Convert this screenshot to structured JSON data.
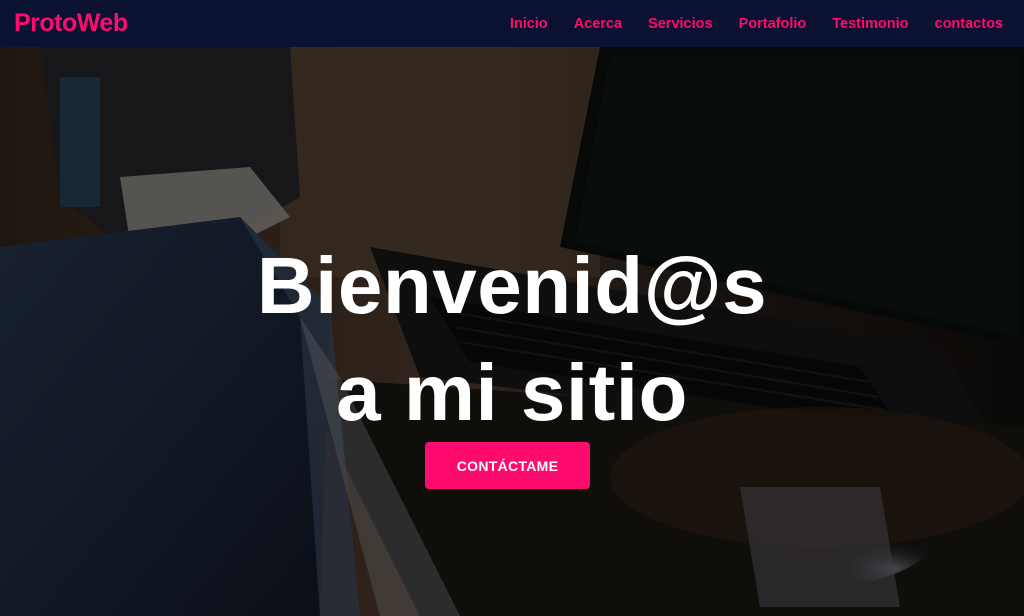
{
  "colors": {
    "accent": "#ff0b6e",
    "navbar_bg": "#0b1130",
    "hero_text": "#ffffff"
  },
  "navbar": {
    "brand": "ProtoWeb",
    "links": [
      {
        "label": "Inicio"
      },
      {
        "label": "Acerca"
      },
      {
        "label": "Servicios"
      },
      {
        "label": "Portafolio"
      },
      {
        "label": "Testimonio"
      },
      {
        "label": "contactos"
      }
    ]
  },
  "hero": {
    "title_line1": "Bienvenid@s",
    "title_line2": "a mi sitio",
    "cta_label": "CONTÁCTAME"
  }
}
